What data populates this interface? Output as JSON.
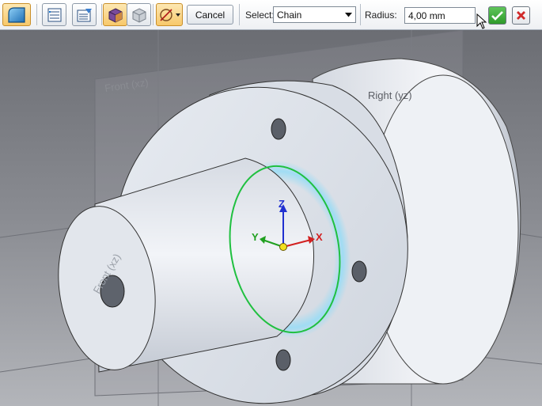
{
  "toolbar": {
    "icons": [
      "round-feature-icon",
      "step-list-icon",
      "properties-icon",
      "solid-body-icon",
      "surface-body-icon",
      "fillet-options-icon"
    ],
    "cancel_label": "Cancel",
    "select_label": "Select:",
    "select_value": "Chain",
    "radius_label": "Radius:",
    "radius_value": "4,00 mm",
    "colors": {
      "accept": "#2e9a2a",
      "reject": "#d12a2a",
      "active_highlight": "#f7c86a"
    }
  },
  "viewport": {
    "plane_front_label": "Front (xz)",
    "plane_right_label": "Right (yz)",
    "axis_x": "X",
    "axis_y": "Y",
    "axis_z": "Z",
    "colors": {
      "part": "#dde3ec",
      "edge_highlight": "#20c040",
      "selection_glow": "#9adcf5",
      "axis_x": "#d22020",
      "axis_y": "#20a020",
      "axis_z": "#2030d0"
    }
  }
}
